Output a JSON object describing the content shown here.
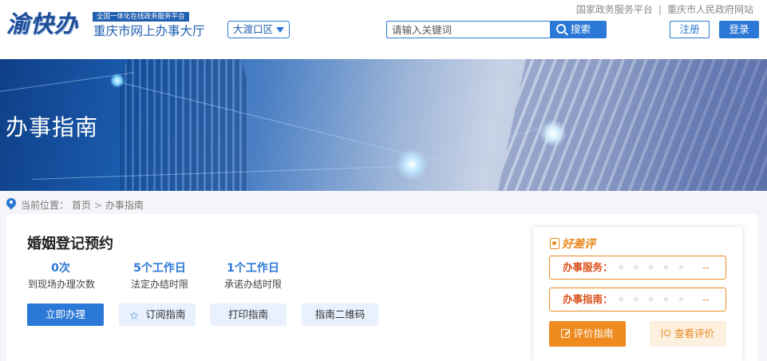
{
  "header": {
    "logo_text": "渝快办",
    "slogan": "全国一体化在线政务服务平台",
    "site_name": "重庆市网上办事大厅",
    "region": "大渡口区",
    "search_placeholder": "请输入关键词",
    "search_button": "搜索",
    "link_national": "国家政务服务平台",
    "link_separator": "|",
    "link_city": "重庆市人民政府网站",
    "register": "注册",
    "login": "登录"
  },
  "banner": {
    "title": "办事指南"
  },
  "breadcrumb": {
    "prefix": "当前位置：",
    "home": "首页",
    "arrow": ">",
    "current": "办事指南"
  },
  "item": {
    "title": "婚姻登记预约",
    "stats": [
      {
        "value": "0次",
        "label": "到现场办理次数"
      },
      {
        "value": "5个工作日",
        "label": "法定办结时限"
      },
      {
        "value": "1个工作日",
        "label": "承诺办结时限"
      }
    ],
    "actions": {
      "apply": "立即办理",
      "subscribe": "订阅指南",
      "print": "打印指南",
      "qrcode": "指南二维码"
    }
  },
  "rating": {
    "title": "好差评",
    "rows": [
      {
        "label": "办事服务：",
        "stars": "★★★★★",
        "score": "--"
      },
      {
        "label": "办事指南：",
        "stars": "★★★★★",
        "score": "--"
      }
    ],
    "evaluate_button": "评价指南",
    "view_button": "查看评价"
  },
  "colors": {
    "primary": "#2b78d6",
    "accent": "#ee8a1e",
    "background": "#f3f5f8"
  }
}
